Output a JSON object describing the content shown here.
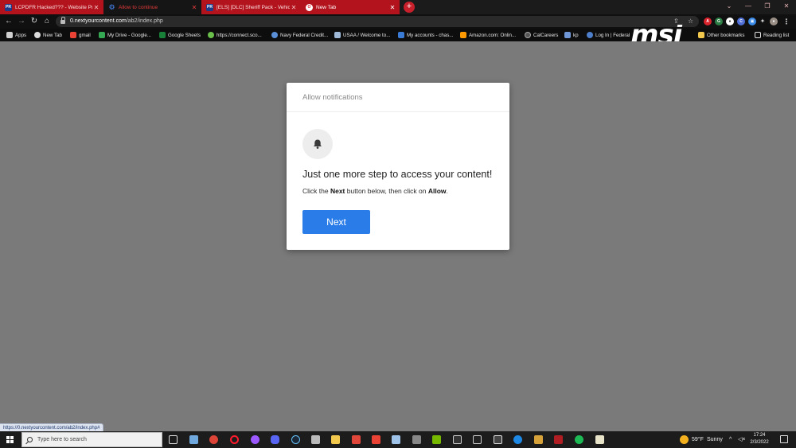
{
  "tabs": [
    {
      "title": "LCPDFR Hacked??? - Website Pro",
      "icon": "lspdfr-icon",
      "style": "red"
    },
    {
      "title": "Allow to continue",
      "icon": "gear-icon",
      "style": "black"
    },
    {
      "title": "[ELS] [DLC] Sheriff Pack - Vehicle",
      "icon": "lspdfr-icon",
      "style": "red"
    },
    {
      "title": "New Tab",
      "icon": "opera-icon",
      "style": "active"
    }
  ],
  "address_bar": {
    "url_host": "0.nextyourcontent.com",
    "url_path": "/ab2/index.php"
  },
  "bookmarks": [
    {
      "label": "Apps",
      "icon": "apps-grid-icon",
      "color": "#e6e6e6"
    },
    {
      "label": "New Tab",
      "icon": "globe-icon",
      "color": "#dcdcdc"
    },
    {
      "label": "gmail",
      "icon": "gmail-icon",
      "color": "#ea4335"
    },
    {
      "label": "My Drive - Google...",
      "icon": "drive-icon",
      "color": "#34a853"
    },
    {
      "label": "Google Sheets",
      "icon": "sheets-icon",
      "color": "#188038"
    },
    {
      "label": "https://connect.sco...",
      "icon": "link-icon",
      "color": "#6abf4b"
    },
    {
      "label": "Navy Federal Credit...",
      "icon": "globe-icon",
      "color": "#5a8fd8"
    },
    {
      "label": "USAA / Welcome to...",
      "icon": "usaa-icon",
      "color": "#9fb9d8"
    },
    {
      "label": "My accounts - chas...",
      "icon": "chase-icon",
      "color": "#3a7bd5"
    },
    {
      "label": "Amazon.com: Onlin...",
      "icon": "amazon-icon",
      "color": "#ff9900"
    },
    {
      "label": "CalCareers",
      "icon": "calcareers-icon",
      "color": "#a0a0a0"
    },
    {
      "label": "kp",
      "icon": "kp-icon",
      "color": "#6f97d6"
    },
    {
      "label": "Log In | Federal",
      "icon": "federal-icon",
      "color": "#4d7fcc"
    },
    {
      "label": "Other bookmarks",
      "icon": "folder-icon",
      "color": "#f2c94c"
    },
    {
      "label": "Reading list",
      "icon": "reading-list-icon",
      "color": "#e6e6e6"
    }
  ],
  "brand": {
    "logo_text": "msi"
  },
  "dialog": {
    "header": "Allow notifications",
    "heading": "Just one more step to access your content!",
    "subtext_pre": "Click the ",
    "subtext_bold1": "Next",
    "subtext_mid": " button below, then click on ",
    "subtext_bold2": "Allow",
    "subtext_post": ".",
    "button_label": "Next",
    "button_color": "#2a7ce8"
  },
  "status_bar": {
    "link_url": "https://0.nextyourcontent.com/ab2/index.php#"
  },
  "taskbar": {
    "search_placeholder": "Type here to search",
    "weather_temp": "59°F",
    "weather_desc": "Sunny",
    "time": "17:24",
    "date": "2/3/2022"
  },
  "colors": {
    "tab_red": "#b3131d",
    "page_bg": "#7a7a7a",
    "accent_blue": "#2a7ce8"
  }
}
